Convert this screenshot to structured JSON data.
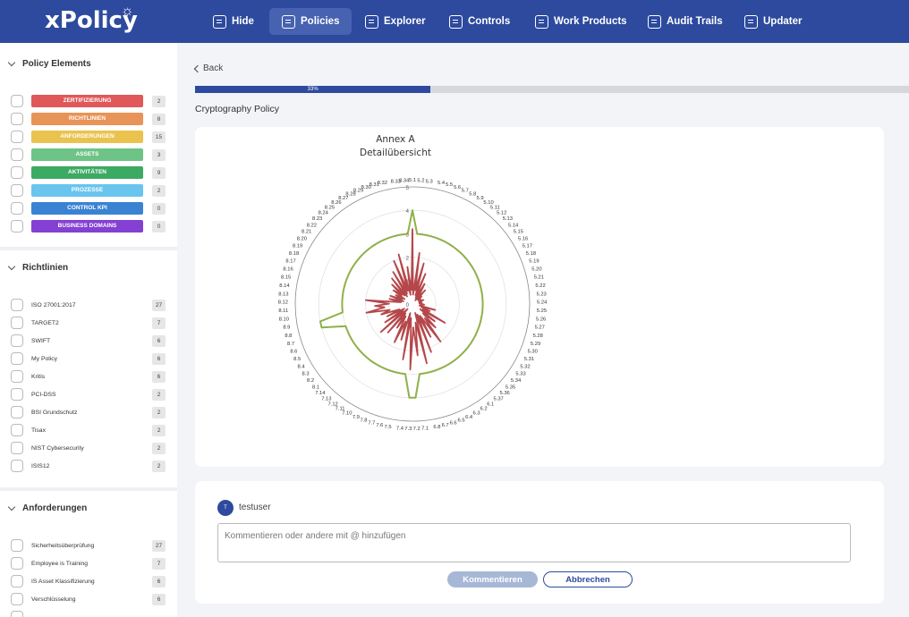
{
  "app": {
    "logo": "xPolicy"
  },
  "nav": [
    {
      "label": "Hide",
      "icon": "hide-panel-icon",
      "active": false
    },
    {
      "label": "Policies",
      "icon": "document-icon",
      "active": true
    },
    {
      "label": "Explorer",
      "icon": "laptop-icon",
      "active": false
    },
    {
      "label": "Controls",
      "icon": "checklist-icon",
      "active": false
    },
    {
      "label": "Work Products",
      "icon": "bar-chart-icon",
      "active": false
    },
    {
      "label": "Audit Trails",
      "icon": "grid-icon",
      "active": false
    },
    {
      "label": "Updater",
      "icon": "clipboard-icon",
      "active": false
    }
  ],
  "sidebar": {
    "sections": [
      {
        "title": "Policy Elements",
        "items": [
          {
            "label": "ZERTIFIZIERUNG",
            "count": "2",
            "color": "#e0585a"
          },
          {
            "label": "RICHTLINIEN",
            "count": "8",
            "color": "#e89458"
          },
          {
            "label": "ANFORDERUNGEN",
            "count": "15",
            "color": "#eac34f"
          },
          {
            "label": "ASSETS",
            "count": "3",
            "color": "#6ec386"
          },
          {
            "label": "AKTIVITÄTEN",
            "count": "9",
            "color": "#3daa63"
          },
          {
            "label": "PROZESSE",
            "count": "2",
            "color": "#69c4ee"
          },
          {
            "label": "CONTROL KPI",
            "count": "0",
            "color": "#3a83d3"
          },
          {
            "label": "BUSINESS DOMAINS",
            "count": "0",
            "color": "#8440d2"
          }
        ]
      },
      {
        "title": "Richtlinien",
        "items": [
          {
            "label": "ISO 27001:2017",
            "count": "27"
          },
          {
            "label": "TARGET2",
            "count": "7"
          },
          {
            "label": "SWIFT",
            "count": "6"
          },
          {
            "label": "My Policy",
            "count": "6"
          },
          {
            "label": "Kritis",
            "count": "6"
          },
          {
            "label": "PCI-DSS",
            "count": "2"
          },
          {
            "label": "BSI Grundschutz",
            "count": "2"
          },
          {
            "label": "Tisax",
            "count": "2"
          },
          {
            "label": "NIST Cybersecurity",
            "count": "2"
          },
          {
            "label": "ISIS12",
            "count": "2"
          }
        ]
      },
      {
        "title": "Anforderungen",
        "items": [
          {
            "label": "Sicherheitsüberprüfung",
            "count": "27"
          },
          {
            "label": "Employee is Training",
            "count": "7"
          },
          {
            "label": "IS Asset Klassifizierung",
            "count": "6"
          },
          {
            "label": "Verschlüsselung",
            "count": "6"
          }
        ]
      }
    ]
  },
  "main": {
    "back_label": "Back",
    "progress": {
      "value": 0.33,
      "label": "33%"
    },
    "policy_title": "Cryptography Policy",
    "chart": {
      "title_line1": "Annex A",
      "title_line2": "Detailübersicht"
    },
    "comment": {
      "username": "testuser",
      "avatar_initial": "T",
      "placeholder": "Kommentieren oder andere mit @ hinzufügen",
      "submit_label": "Kommentieren",
      "cancel_label": "Abbrechen"
    }
  },
  "chart_data": {
    "type": "radar",
    "title": "Annex A Detailübersicht",
    "r_ticks": [
      "0",
      "1",
      "2",
      "3",
      "4",
      "5"
    ],
    "rlim": [
      0,
      5
    ],
    "categories": [
      "5.1",
      "5.2",
      "5.3",
      "5.4",
      "5.5",
      "5.6",
      "5.7",
      "5.8",
      "5.9",
      "5.10",
      "5.11",
      "5.12",
      "5.13",
      "5.14",
      "5.15",
      "5.16",
      "5.17",
      "5.18",
      "5.19",
      "5.20",
      "5.21",
      "5.22",
      "5.23",
      "5.24",
      "5.25",
      "5.26",
      "5.27",
      "5.28",
      "5.29",
      "5.30",
      "5.31",
      "5.32",
      "5.33",
      "5.34",
      "5.35",
      "5.36",
      "5.37",
      "6.1",
      "6.2",
      "6.3",
      "6.4",
      "6.5",
      "6.6",
      "6.7",
      "6.8",
      "7.1",
      "7.2",
      "7.3",
      "7.4",
      "7.5",
      "7.6",
      "7.7",
      "7.8",
      "7.9",
      "7.10",
      "7.11",
      "7.12",
      "7.13",
      "7.14",
      "8.1",
      "8.2",
      "8.3",
      "8.4",
      "8.5",
      "8.6",
      "8.7",
      "8.8",
      "8.9",
      "8.10",
      "8.11",
      "8.12",
      "8.13",
      "8.14",
      "8.15",
      "8.16",
      "8.17",
      "8.18",
      "8.19",
      "8.20",
      "8.21",
      "8.22",
      "8.23",
      "8.24",
      "8.25",
      "8.26",
      "8.27",
      "8.28",
      "8.29",
      "8.30",
      "8.31",
      "8.32",
      "8.33",
      "8.34"
    ],
    "series": [
      {
        "color": "#8fb04a",
        "values": [
          4.0,
          3.0,
          3.0,
          3.0,
          3.0,
          3.0,
          3.0,
          3.0,
          3.0,
          3.0,
          3.0,
          3.0,
          3.0,
          3.0,
          3.0,
          3.0,
          3.0,
          3.0,
          3.0,
          3.0,
          3.0,
          3.0,
          3.0,
          3.0,
          3.0,
          3.0,
          3.0,
          3.0,
          3.0,
          3.0,
          3.0,
          3.0,
          3.0,
          3.0,
          3.0,
          3.0,
          3.0,
          3.0,
          3.0,
          3.0,
          3.0,
          3.0,
          3.0,
          3.0,
          3.0,
          3.0,
          4.0,
          4.0,
          3.0,
          3.0,
          3.0,
          3.0,
          3.0,
          3.0,
          3.0,
          3.0,
          3.0,
          3.0,
          3.0,
          3.0,
          3.0,
          3.0,
          3.0,
          3.0,
          3.0,
          3.0,
          4.0,
          4.0,
          3.0,
          3.0,
          3.0,
          3.0,
          3.0,
          3.0,
          3.0,
          3.0,
          3.0,
          3.0,
          3.0,
          3.0,
          3.0,
          3.0,
          3.0,
          3.0,
          3.0,
          3.0,
          3.0,
          3.0,
          3.0,
          3.0,
          3.0,
          3.0,
          3.0
        ]
      },
      {
        "color": "#b5474b",
        "values": [
          3.2,
          0.4,
          2.2,
          0.6,
          1.8,
          0.4,
          1.4,
          0.3,
          1.0,
          0.6,
          0.2,
          0.8,
          0.3,
          0.5,
          0.3,
          0.4,
          0.4,
          0.3,
          0.5,
          0.3,
          0.3,
          0.4,
          0.3,
          0.4,
          0.5,
          0.4,
          0.3,
          1.0,
          0.4,
          0.8,
          0.5,
          1.6,
          0.4,
          1.2,
          0.6,
          1.4,
          0.8,
          2.0,
          0.6,
          1.6,
          0.5,
          2.2,
          0.4,
          2.6,
          0.8,
          2.2,
          1.0,
          2.8,
          0.6,
          2.4,
          0.4,
          1.6,
          0.8,
          1.8,
          0.6,
          1.2,
          0.5,
          1.6,
          0.3,
          1.8,
          0.5,
          1.4,
          0.4,
          1.2,
          0.6,
          1.4,
          1.0,
          2.0,
          1.2,
          1.6,
          1.0,
          2.0,
          0.5,
          1.0,
          0.4,
          1.0,
          0.5,
          0.8,
          0.4,
          1.0,
          0.6,
          1.2,
          0.5,
          1.4,
          0.4,
          1.6,
          0.5,
          2.0,
          0.6,
          2.2,
          0.4,
          1.6,
          0.6
        ]
      }
    ]
  }
}
